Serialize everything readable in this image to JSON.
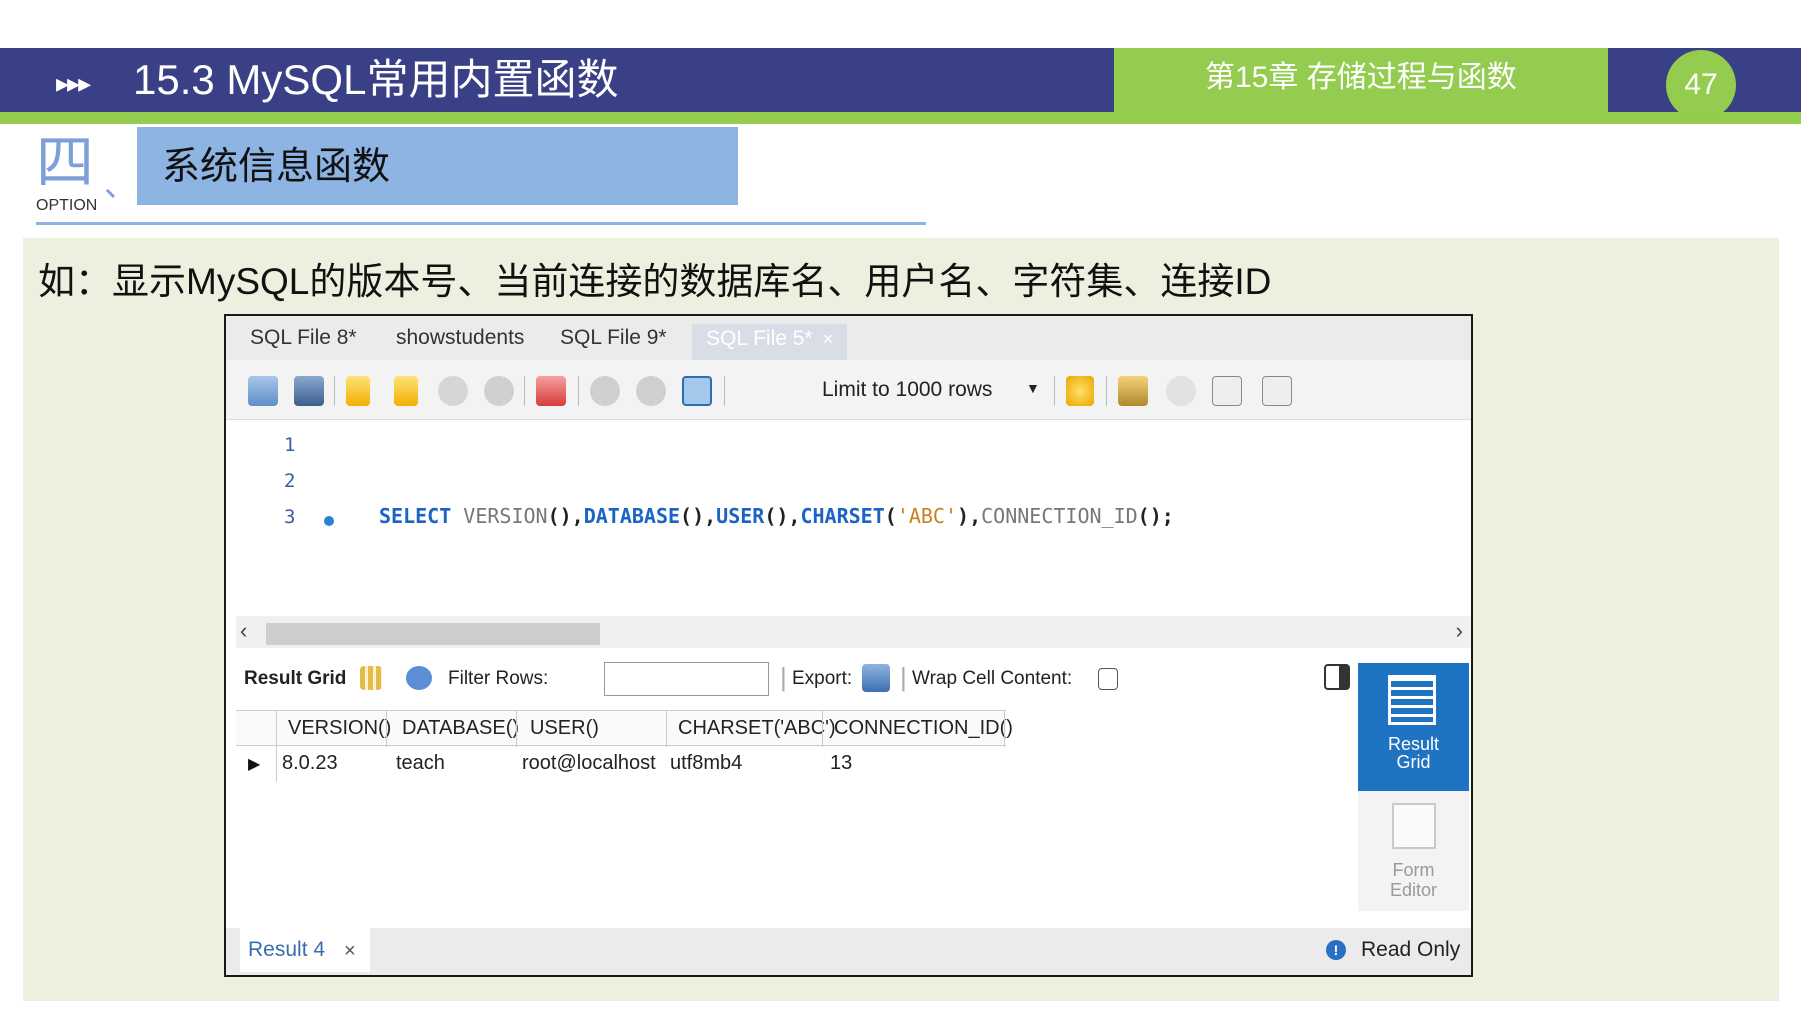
{
  "header": {
    "arrows": "▸▸▸",
    "title": "15.3 MySQL常用内置函数",
    "chapter": "第15章 存储过程与函数",
    "page_number": "47"
  },
  "section": {
    "number": "四",
    "separator": "、",
    "option_label": "OPTION",
    "title": "系统信息函数"
  },
  "caption": "如：显示MySQL的版本号、当前连接的数据库名、用户名、字符集、连接ID",
  "workbench": {
    "tabs": [
      "SQL File 8*",
      "showstudents",
      "SQL File 9*",
      "SQL File 5*"
    ],
    "active_tab_close": "×",
    "limit_label": "Limit to 1000 rows",
    "line_numbers": [
      "1",
      "2",
      "3"
    ],
    "code": {
      "select": "SELECT",
      "version": "VERSION",
      "database": "DATABASE",
      "user": "USER",
      "charset": "CHARSET",
      "string_arg": "'ABC'",
      "connection_id": "CONNECTION_ID"
    },
    "result_bar": {
      "result_grid": "Result Grid",
      "filter_rows": "Filter Rows:",
      "export": "Export:",
      "wrap_cell": "Wrap Cell Content:"
    },
    "grid": {
      "columns": [
        "VERSION()",
        "DATABASE()",
        "USER()",
        "CHARSET('ABC')",
        "CONNECTION_ID()"
      ],
      "rows": [
        [
          "8.0.23",
          "teach",
          "root@localhost",
          "utf8mb4",
          "13"
        ]
      ]
    },
    "side_panel": {
      "result_grid_line1": "Result",
      "result_grid_line2": "Grid",
      "form_editor_line1": "Form",
      "form_editor_line2": "Editor"
    },
    "status": {
      "result_tab": "Result 4",
      "result_tab_close": "×",
      "read_only": "Read Only"
    }
  },
  "colors": {
    "header_blue": "#3a4086",
    "header_green": "#93cc4e",
    "section_blue": "#8eb4e3",
    "panel_bg": "#ebf1de",
    "keyword_blue": "#1b63c4",
    "string_orange": "#c8841a"
  }
}
